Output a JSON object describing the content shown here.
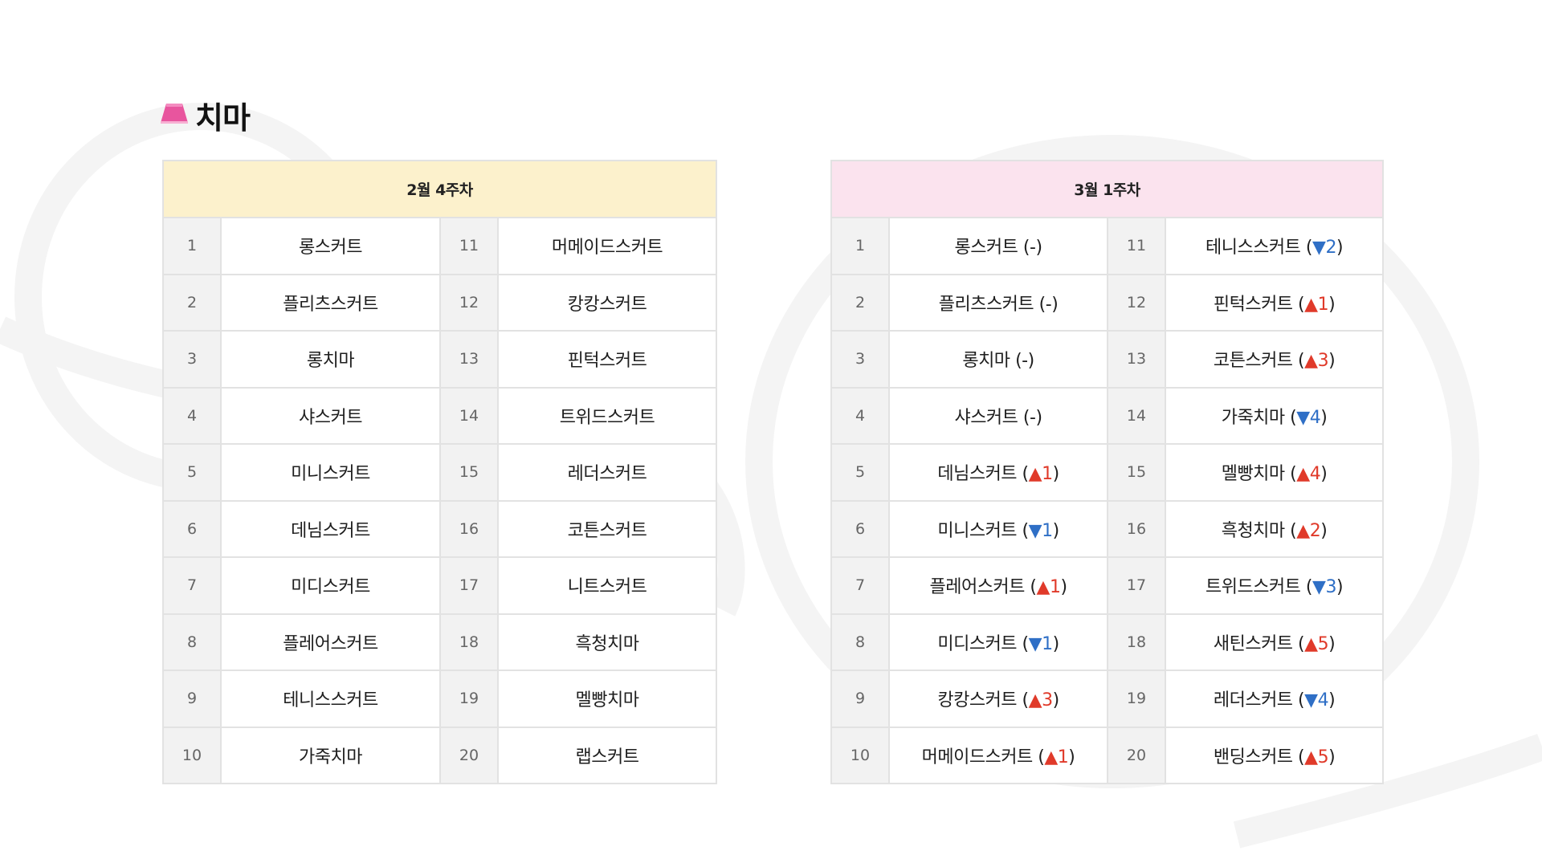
{
  "section": {
    "title": "치마",
    "icon": "skirt-icon",
    "icon_color": "#e8559e"
  },
  "colors": {
    "left_header_bg": "#fcf1cc",
    "right_header_bg": "#fbe3ee",
    "rank_up": "#e03a2a",
    "rank_down": "#2f6fc6"
  },
  "left_table": {
    "header": "2월 4주차",
    "rows": [
      {
        "rank_a": "1",
        "name_a": "롱스커트",
        "rank_b": "11",
        "name_b": "머메이드스커트"
      },
      {
        "rank_a": "2",
        "name_a": "플리츠스커트",
        "rank_b": "12",
        "name_b": "캉캉스커트"
      },
      {
        "rank_a": "3",
        "name_a": "롱치마",
        "rank_b": "13",
        "name_b": "핀턱스커트"
      },
      {
        "rank_a": "4",
        "name_a": "샤스커트",
        "rank_b": "14",
        "name_b": "트위드스커트"
      },
      {
        "rank_a": "5",
        "name_a": "미니스커트",
        "rank_b": "15",
        "name_b": "레더스커트"
      },
      {
        "rank_a": "6",
        "name_a": "데님스커트",
        "rank_b": "16",
        "name_b": "코튼스커트"
      },
      {
        "rank_a": "7",
        "name_a": "미디스커트",
        "rank_b": "17",
        "name_b": "니트스커트"
      },
      {
        "rank_a": "8",
        "name_a": "플레어스커트",
        "rank_b": "18",
        "name_b": "흑청치마"
      },
      {
        "rank_a": "9",
        "name_a": "테니스스커트",
        "rank_b": "19",
        "name_b": "멜빵치마"
      },
      {
        "rank_a": "10",
        "name_a": "가죽치마",
        "rank_b": "20",
        "name_b": "랩스커트"
      }
    ]
  },
  "right_table": {
    "header": "3월 1주차",
    "rows": [
      {
        "rank_a": "1",
        "name_a": "롱스커트",
        "chg_a": {
          "dir": "none",
          "text": "(-)"
        },
        "rank_b": "11",
        "name_b": "테니스스커트",
        "chg_b": {
          "dir": "down",
          "num": "2"
        }
      },
      {
        "rank_a": "2",
        "name_a": "플리츠스커트",
        "chg_a": {
          "dir": "none",
          "text": "(-)"
        },
        "rank_b": "12",
        "name_b": "핀턱스커트",
        "chg_b": {
          "dir": "up",
          "num": "1"
        }
      },
      {
        "rank_a": "3",
        "name_a": "롱치마",
        "chg_a": {
          "dir": "none",
          "text": "(-)"
        },
        "rank_b": "13",
        "name_b": "코튼스커트",
        "chg_b": {
          "dir": "up",
          "num": "3"
        }
      },
      {
        "rank_a": "4",
        "name_a": "샤스커트",
        "chg_a": {
          "dir": "none",
          "text": "(-)"
        },
        "rank_b": "14",
        "name_b": "가죽치마",
        "chg_b": {
          "dir": "down",
          "num": "4"
        }
      },
      {
        "rank_a": "5",
        "name_a": "데님스커트",
        "chg_a": {
          "dir": "up",
          "num": "1"
        },
        "rank_b": "15",
        "name_b": "멜빵치마",
        "chg_b": {
          "dir": "up",
          "num": "4"
        }
      },
      {
        "rank_a": "6",
        "name_a": "미니스커트",
        "chg_a": {
          "dir": "down",
          "num": "1"
        },
        "rank_b": "16",
        "name_b": "흑청치마",
        "chg_b": {
          "dir": "up",
          "num": "2"
        }
      },
      {
        "rank_a": "7",
        "name_a": "플레어스커트",
        "chg_a": {
          "dir": "up",
          "num": "1"
        },
        "rank_b": "17",
        "name_b": "트위드스커트",
        "chg_b": {
          "dir": "down",
          "num": "3"
        }
      },
      {
        "rank_a": "8",
        "name_a": "미디스커트",
        "chg_a": {
          "dir": "down",
          "num": "1"
        },
        "rank_b": "18",
        "name_b": "새틴스커트",
        "chg_b": {
          "dir": "up",
          "num": "5"
        }
      },
      {
        "rank_a": "9",
        "name_a": "캉캉스커트",
        "chg_a": {
          "dir": "up",
          "num": "3"
        },
        "rank_b": "19",
        "name_b": "레더스커트",
        "chg_b": {
          "dir": "down",
          "num": "4"
        }
      },
      {
        "rank_a": "10",
        "name_a": "머메이드스커트",
        "chg_a": {
          "dir": "up",
          "num": "1"
        },
        "rank_b": "20",
        "name_b": "밴딩스커트",
        "chg_b": {
          "dir": "up",
          "num": "5"
        }
      }
    ]
  }
}
